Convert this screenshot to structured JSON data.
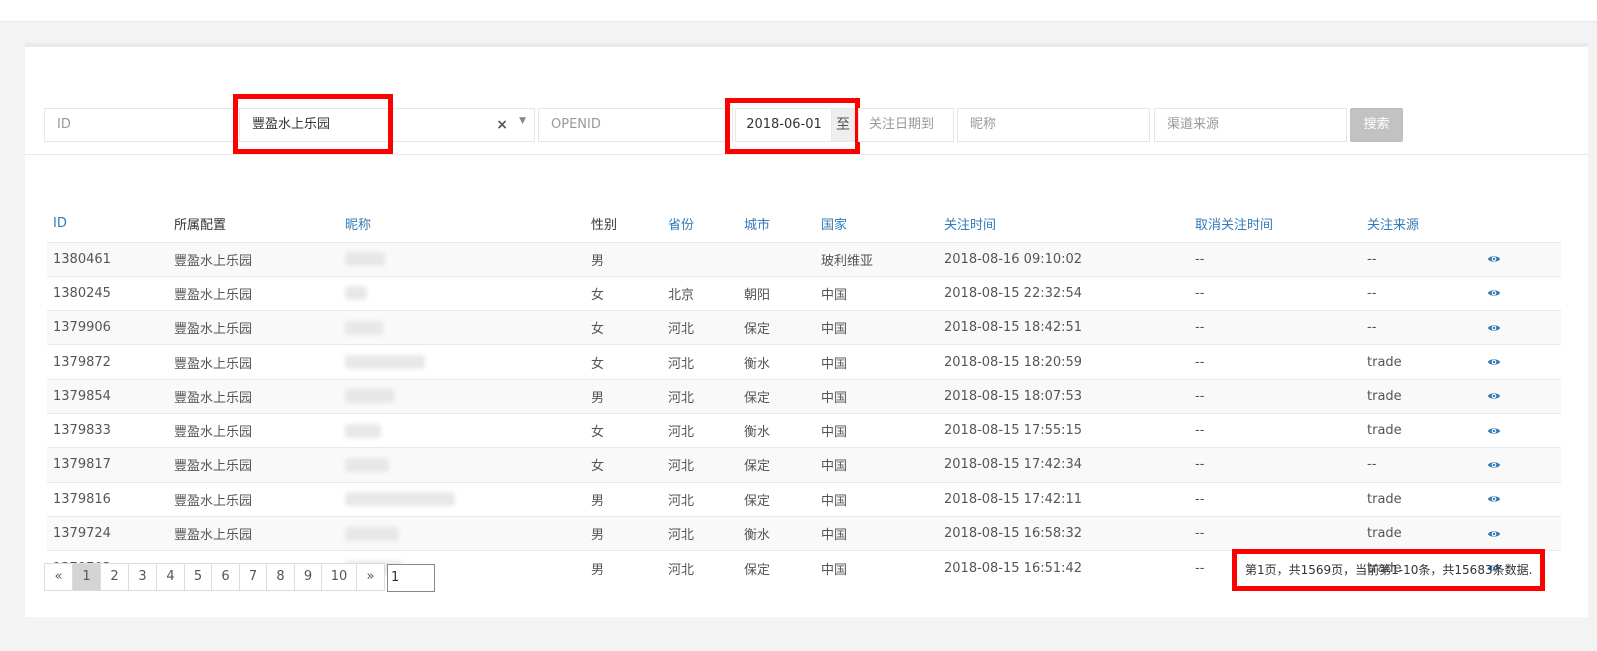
{
  "filters": {
    "id_placeholder": "ID",
    "config_value": "豐盈水上乐园",
    "clear_symbol": "×",
    "openid_placeholder": "OPENID",
    "date_from": "2018-06-01",
    "date_sep": "至",
    "date_to_placeholder": "关注日期到",
    "nickname_placeholder": "昵称",
    "channel_placeholder": "渠道来源",
    "search_label": "搜索"
  },
  "table": {
    "headers": [
      "ID",
      "所属配置",
      "昵称",
      "性别",
      "省份",
      "城市",
      "国家",
      "关注时间",
      "取消关注时间",
      "关注来源"
    ],
    "rows": [
      {
        "id": "1380461",
        "config": "豐盈水上乐园",
        "gender": "男",
        "province": "",
        "city": "",
        "country": "玻利维亚",
        "follow": "2018-08-16 09:10:02",
        "unfollow": "--",
        "source": "--"
      },
      {
        "id": "1380245",
        "config": "豐盈水上乐园",
        "gender": "女",
        "province": "北京",
        "city": "朝阳",
        "country": "中国",
        "follow": "2018-08-15 22:32:54",
        "unfollow": "--",
        "source": "--"
      },
      {
        "id": "1379906",
        "config": "豐盈水上乐园",
        "gender": "女",
        "province": "河北",
        "city": "保定",
        "country": "中国",
        "follow": "2018-08-15 18:42:51",
        "unfollow": "--",
        "source": "--"
      },
      {
        "id": "1379872",
        "config": "豐盈水上乐园",
        "gender": "女",
        "province": "河北",
        "city": "衡水",
        "country": "中国",
        "follow": "2018-08-15 18:20:59",
        "unfollow": "--",
        "source": "trade"
      },
      {
        "id": "1379854",
        "config": "豐盈水上乐园",
        "gender": "男",
        "province": "河北",
        "city": "保定",
        "country": "中国",
        "follow": "2018-08-15 18:07:53",
        "unfollow": "--",
        "source": "trade"
      },
      {
        "id": "1379833",
        "config": "豐盈水上乐园",
        "gender": "女",
        "province": "河北",
        "city": "衡水",
        "country": "中国",
        "follow": "2018-08-15 17:55:15",
        "unfollow": "--",
        "source": "trade"
      },
      {
        "id": "1379817",
        "config": "豐盈水上乐园",
        "gender": "女",
        "province": "河北",
        "city": "保定",
        "country": "中国",
        "follow": "2018-08-15 17:42:34",
        "unfollow": "--",
        "source": "--"
      },
      {
        "id": "1379816",
        "config": "豐盈水上乐园",
        "gender": "男",
        "province": "河北",
        "city": "保定",
        "country": "中国",
        "follow": "2018-08-15 17:42:11",
        "unfollow": "--",
        "source": "trade"
      },
      {
        "id": "1379724",
        "config": "豐盈水上乐园",
        "gender": "男",
        "province": "河北",
        "city": "衡水",
        "country": "中国",
        "follow": "2018-08-15 16:58:32",
        "unfollow": "--",
        "source": "trade"
      },
      {
        "id": "1379703",
        "config": "豐盈水上乐园",
        "gender": "男",
        "province": "河北",
        "city": "保定",
        "country": "中国",
        "follow": "2018-08-15 16:51:42",
        "unfollow": "--",
        "source": "trade"
      }
    ]
  },
  "pagination": {
    "prev": "«",
    "pages": [
      "1",
      "2",
      "3",
      "4",
      "5",
      "6",
      "7",
      "8",
      "9",
      "10"
    ],
    "next": "»",
    "jump_value": "1",
    "info": "第1页，共1569页，当前第1-10条，共15683条数据."
  },
  "colors": {
    "link": "#337ab7",
    "highlight": "#ff0000",
    "search_button": "#c2c2c2"
  }
}
